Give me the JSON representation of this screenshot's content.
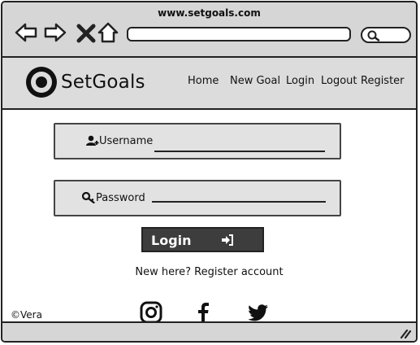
{
  "browser": {
    "url": "www.setgoals.com",
    "icons": [
      "back-arrow-icon",
      "forward-arrow-icon",
      "close-x-icon",
      "home-icon",
      "search-icon"
    ]
  },
  "header": {
    "brand": "SetGoals",
    "logo_icon": "target-logo-icon",
    "nav": [
      "Home",
      "New Goal",
      "Login",
      "Logout",
      "Register"
    ]
  },
  "form": {
    "username_label": "Username",
    "username_value": "",
    "password_label": "Password",
    "password_value": "",
    "login_label": "Login",
    "register_link": "New here? Register account"
  },
  "footer": {
    "copyright": "©Vera",
    "social_icons": [
      "instagram-icon",
      "facebook-icon",
      "twitter-icon"
    ]
  },
  "colors": {
    "chrome_gray": "#d6d6d6",
    "field_gray": "#e2e2e2",
    "button_dark": "#3d3d3d"
  }
}
